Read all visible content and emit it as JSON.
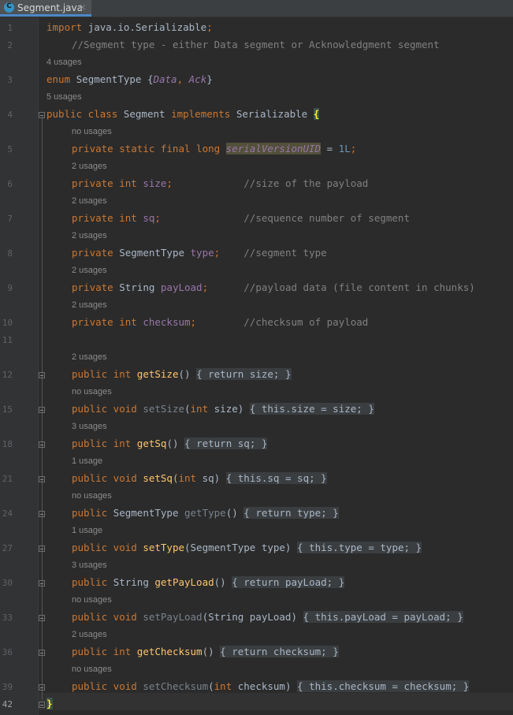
{
  "tab": {
    "icon": "class-icon",
    "icon_letter": "C",
    "title": "Segment.java",
    "close": "×"
  },
  "lines": [
    {
      "n": "1",
      "hint": "",
      "indent": 0,
      "seg": [
        [
          "kw",
          "import "
        ],
        [
          "",
          "java.io.Serializable"
        ],
        [
          "kw",
          ";"
        ]
      ]
    },
    {
      "n": "2",
      "hint": "",
      "indent": 1,
      "seg": [
        [
          "cm",
          "//Segment type - either Data segment or Acknowledgment segment"
        ]
      ]
    },
    {
      "n": "3",
      "hint": "4 usages",
      "indent": 0,
      "seg": [
        [
          "kw",
          "enum "
        ],
        [
          "",
          "SegmentType "
        ],
        [
          "",
          "{"
        ],
        [
          "fdi",
          "Data"
        ],
        [
          "kw",
          ", "
        ],
        [
          "fdi",
          "Ack"
        ],
        [
          "",
          "}"
        ]
      ]
    },
    {
      "n": "4",
      "hint": "5 usages",
      "indent": 0,
      "fold": true,
      "seg": [
        [
          "kw",
          "public class "
        ],
        [
          "",
          "Segment "
        ],
        [
          "kw",
          "implements "
        ],
        [
          "",
          "Serializable "
        ],
        [
          "brace-match",
          "{"
        ]
      ]
    },
    {
      "n": "5",
      "hint": "no usages",
      "indent": 1,
      "seg": [
        [
          "kw",
          "private static final long "
        ],
        [
          "fdi hl",
          "serialVersionUID"
        ],
        [
          "",
          " = "
        ],
        [
          "num",
          "1L"
        ],
        [
          "kw",
          ";"
        ]
      ]
    },
    {
      "n": "6",
      "hint": "2 usages",
      "indent": 1,
      "seg": [
        [
          "kw",
          "private int "
        ],
        [
          "fd",
          "size"
        ],
        [
          "kw",
          ";"
        ],
        [
          "",
          "            "
        ],
        [
          "cm",
          "//size of the payload"
        ]
      ]
    },
    {
      "n": "7",
      "hint": "2 usages",
      "indent": 1,
      "seg": [
        [
          "kw",
          "private int "
        ],
        [
          "fd",
          "sq"
        ],
        [
          "kw",
          ";"
        ],
        [
          "",
          "              "
        ],
        [
          "cm",
          "//sequence number of segment"
        ]
      ]
    },
    {
      "n": "8",
      "hint": "2 usages",
      "indent": 1,
      "seg": [
        [
          "kw",
          "private "
        ],
        [
          "",
          "SegmentType "
        ],
        [
          "fd",
          "type"
        ],
        [
          "kw",
          ";"
        ],
        [
          "",
          "    "
        ],
        [
          "cm",
          "//segment type"
        ]
      ]
    },
    {
      "n": "9",
      "hint": "2 usages",
      "indent": 1,
      "seg": [
        [
          "kw",
          "private "
        ],
        [
          "",
          "String "
        ],
        [
          "fd",
          "payLoad"
        ],
        [
          "kw",
          ";"
        ],
        [
          "",
          "      "
        ],
        [
          "cm",
          "//payload data (file content in chunks)"
        ]
      ]
    },
    {
      "n": "10",
      "hint": "2 usages",
      "indent": 1,
      "seg": [
        [
          "kw",
          "private int "
        ],
        [
          "fd",
          "checksum"
        ],
        [
          "kw",
          ";"
        ],
        [
          "",
          "        "
        ],
        [
          "cm",
          "//checksum of payload"
        ]
      ]
    },
    {
      "n": "11",
      "hint": "",
      "indent": 1,
      "seg": []
    },
    {
      "n": "12",
      "hint": "2 usages",
      "indent": 1,
      "fold": true,
      "seg": [
        [
          "kw",
          "public int "
        ],
        [
          "fn",
          "getSize"
        ],
        [
          "",
          "() "
        ],
        [
          "br",
          "{ "
        ],
        [
          "kw br",
          "return "
        ],
        [
          "fd br",
          "size"
        ],
        [
          "kw br",
          ";"
        ],
        [
          "br",
          " }"
        ]
      ]
    },
    {
      "n": "15",
      "hint": "no usages",
      "indent": 1,
      "fold": true,
      "seg": [
        [
          "kw",
          "public void "
        ],
        [
          "fu",
          "setSize"
        ],
        [
          "",
          "("
        ],
        [
          "kw",
          "int "
        ],
        [
          "",
          "size) "
        ],
        [
          "br",
          "{ "
        ],
        [
          "kw br",
          "this"
        ],
        [
          "br",
          "."
        ],
        [
          "fd br",
          "size"
        ],
        [
          "br",
          " = size"
        ],
        [
          "kw br",
          ";"
        ],
        [
          "br",
          " }"
        ]
      ]
    },
    {
      "n": "18",
      "hint": "3 usages",
      "indent": 1,
      "fold": true,
      "seg": [
        [
          "kw",
          "public int "
        ],
        [
          "fn",
          "getSq"
        ],
        [
          "",
          "() "
        ],
        [
          "br",
          "{ "
        ],
        [
          "kw br",
          "return "
        ],
        [
          "fd br",
          "sq"
        ],
        [
          "kw br",
          ";"
        ],
        [
          "br",
          " }"
        ]
      ]
    },
    {
      "n": "21",
      "hint": "1 usage",
      "indent": 1,
      "fold": true,
      "seg": [
        [
          "kw",
          "public void "
        ],
        [
          "fn",
          "setSq"
        ],
        [
          "",
          "("
        ],
        [
          "kw",
          "int "
        ],
        [
          "",
          "sq) "
        ],
        [
          "br",
          "{ "
        ],
        [
          "kw br",
          "this"
        ],
        [
          "br",
          "."
        ],
        [
          "fd br",
          "sq"
        ],
        [
          "br",
          " = sq"
        ],
        [
          "kw br",
          ";"
        ],
        [
          "br",
          " }"
        ]
      ]
    },
    {
      "n": "24",
      "hint": "no usages",
      "indent": 1,
      "fold": true,
      "seg": [
        [
          "kw",
          "public "
        ],
        [
          "",
          "SegmentType "
        ],
        [
          "fu",
          "getType"
        ],
        [
          "",
          "() "
        ],
        [
          "br",
          "{ "
        ],
        [
          "kw br",
          "return "
        ],
        [
          "fd br",
          "type"
        ],
        [
          "kw br",
          ";"
        ],
        [
          "br",
          " }"
        ]
      ]
    },
    {
      "n": "27",
      "hint": "1 usage",
      "indent": 1,
      "fold": true,
      "seg": [
        [
          "kw",
          "public void "
        ],
        [
          "fn",
          "setType"
        ],
        [
          "",
          "(SegmentType type) "
        ],
        [
          "br",
          "{ "
        ],
        [
          "kw br",
          "this"
        ],
        [
          "br",
          "."
        ],
        [
          "fd br",
          "type"
        ],
        [
          "br",
          " = type"
        ],
        [
          "kw br",
          ";"
        ],
        [
          "br",
          " }"
        ]
      ]
    },
    {
      "n": "30",
      "hint": "3 usages",
      "indent": 1,
      "fold": true,
      "seg": [
        [
          "kw",
          "public "
        ],
        [
          "",
          "String "
        ],
        [
          "fn",
          "getPayLoad"
        ],
        [
          "",
          "() "
        ],
        [
          "br",
          "{ "
        ],
        [
          "kw br",
          "return "
        ],
        [
          "fd br",
          "payLoad"
        ],
        [
          "kw br",
          ";"
        ],
        [
          "br",
          " }"
        ]
      ]
    },
    {
      "n": "33",
      "hint": "no usages",
      "indent": 1,
      "fold": true,
      "seg": [
        [
          "kw",
          "public void "
        ],
        [
          "fu",
          "setPayLoad"
        ],
        [
          "",
          "(String payLoad) "
        ],
        [
          "br",
          "{ "
        ],
        [
          "kw br",
          "this"
        ],
        [
          "br",
          "."
        ],
        [
          "fd br",
          "payLoad"
        ],
        [
          "br",
          " = payLoad"
        ],
        [
          "kw br",
          ";"
        ],
        [
          "br",
          " }"
        ]
      ]
    },
    {
      "n": "36",
      "hint": "2 usages",
      "indent": 1,
      "fold": true,
      "seg": [
        [
          "kw",
          "public int "
        ],
        [
          "fn",
          "getChecksum"
        ],
        [
          "",
          "() "
        ],
        [
          "br",
          "{ "
        ],
        [
          "kw br",
          "return "
        ],
        [
          "fd br",
          "checksum"
        ],
        [
          "kw br",
          ";"
        ],
        [
          "br",
          " }"
        ]
      ]
    },
    {
      "n": "39",
      "hint": "no usages",
      "indent": 1,
      "fold": true,
      "seg": [
        [
          "kw",
          "public void "
        ],
        [
          "fu",
          "setChecksum"
        ],
        [
          "",
          "("
        ],
        [
          "kw",
          "int "
        ],
        [
          "",
          "checksum) "
        ],
        [
          "br",
          "{ "
        ],
        [
          "kw br",
          "this"
        ],
        [
          "br",
          "."
        ],
        [
          "fd br",
          "checksum"
        ],
        [
          "br",
          " = checksum"
        ],
        [
          "kw br",
          ";"
        ],
        [
          "br",
          " }"
        ]
      ]
    },
    {
      "n": "42",
      "hint": "",
      "indent": 0,
      "current": true,
      "fold": true,
      "seg": [
        [
          "brace-match",
          "}"
        ]
      ]
    }
  ]
}
